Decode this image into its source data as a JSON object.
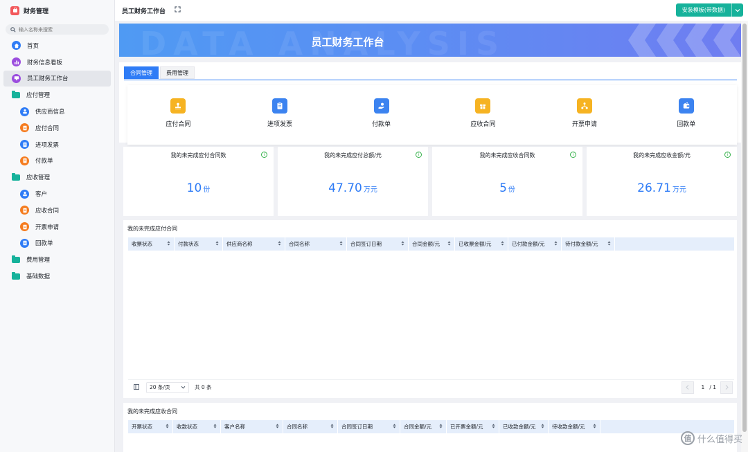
{
  "app": {
    "title": "财务管理",
    "logo_icon": "wallet-icon"
  },
  "search": {
    "placeholder": "输入名称来搜索"
  },
  "sidebar": {
    "items": [
      {
        "label": "首页",
        "icon": "home-icon",
        "color": "#2f7cf6",
        "child": false
      },
      {
        "label": "财务信息看板",
        "icon": "chart-icon",
        "color": "#9b4dde",
        "child": false
      },
      {
        "label": "员工财务工作台",
        "icon": "desk-icon",
        "color": "#9b4dde",
        "child": false,
        "active": true
      },
      {
        "label": "应付管理",
        "icon": "folder-icon",
        "color": "#16b29b",
        "child": false
      },
      {
        "label": "供应商信息",
        "icon": "supplier-icon",
        "color": "#2f7cf6",
        "child": true
      },
      {
        "label": "应付合同",
        "icon": "contract-icon",
        "color": "#f57c1f",
        "child": true
      },
      {
        "label": "进项发票",
        "icon": "invoice-icon",
        "color": "#2f7cf6",
        "child": true
      },
      {
        "label": "付款单",
        "icon": "payment-icon",
        "color": "#f57c1f",
        "child": true
      },
      {
        "label": "应收管理",
        "icon": "folder-icon",
        "color": "#16b29b",
        "child": false
      },
      {
        "label": "客户",
        "icon": "customer-icon",
        "color": "#2f7cf6",
        "child": true
      },
      {
        "label": "应收合同",
        "icon": "contract-icon",
        "color": "#f57c1f",
        "child": true
      },
      {
        "label": "开票申请",
        "icon": "apply-icon",
        "color": "#f57c1f",
        "child": true
      },
      {
        "label": "回款单",
        "icon": "receipt-icon",
        "color": "#2f7cf6",
        "child": true
      },
      {
        "label": "费用管理",
        "icon": "folder-icon",
        "color": "#16b29b",
        "child": false
      },
      {
        "label": "基础数据",
        "icon": "folder-icon",
        "color": "#16b29b",
        "child": false
      }
    ]
  },
  "topbar": {
    "title": "员工财务工作台",
    "install_label": "安装模板(带数据)"
  },
  "banner": {
    "title": "员工财务工作台",
    "watermark": "DATA ANALYSIS"
  },
  "tabs": [
    {
      "label": "合同管理",
      "active": true
    },
    {
      "label": "费用管理",
      "active": false
    }
  ],
  "shortcuts": [
    {
      "label": "应付合同",
      "icon": "stamp-icon",
      "color": "#f6b322"
    },
    {
      "label": "进项发票",
      "icon": "clipboard-icon",
      "color": "#3c83f0"
    },
    {
      "label": "付款单",
      "icon": "hand-pay-icon",
      "color": "#3c83f0"
    },
    {
      "label": "应收合同",
      "icon": "gift-icon",
      "color": "#f6b322"
    },
    {
      "label": "开票申请",
      "icon": "network-icon",
      "color": "#f6b322"
    },
    {
      "label": "回款单",
      "icon": "wallet-icon",
      "color": "#3c83f0"
    }
  ],
  "stats": [
    {
      "title": "我的未完成应付合同数",
      "value": "10",
      "unit": "份"
    },
    {
      "title": "我的未完成应付总额/元",
      "value": "47.70",
      "unit": "万元"
    },
    {
      "title": "我的未完成应收合同数",
      "value": "5",
      "unit": "份"
    },
    {
      "title": "我的未完成应收金额/元",
      "value": "26.71",
      "unit": "万元"
    }
  ],
  "payable_table": {
    "title": "我的未完成应付合同",
    "columns": [
      "收票状态",
      "付款状态",
      "供应商名称",
      "合同名称",
      "合同签订日期",
      "合同金额/元",
      "已收票金额/元",
      "已付款金额/元",
      "待付款金额/元"
    ],
    "page_size": "20 条/页",
    "total": "共 0 条",
    "page_current": "1",
    "page_total": "/ 1"
  },
  "receivable_table": {
    "title": "我的未完成应收合同",
    "columns": [
      "开票状态",
      "收款状态",
      "客户名称",
      "合同名称",
      "合同签订日期",
      "合同金额/元",
      "已开票金额/元",
      "已收款金额/元",
      "待收款金额/元"
    ]
  },
  "watermark": {
    "text": "什么值得买",
    "badge": "值"
  }
}
